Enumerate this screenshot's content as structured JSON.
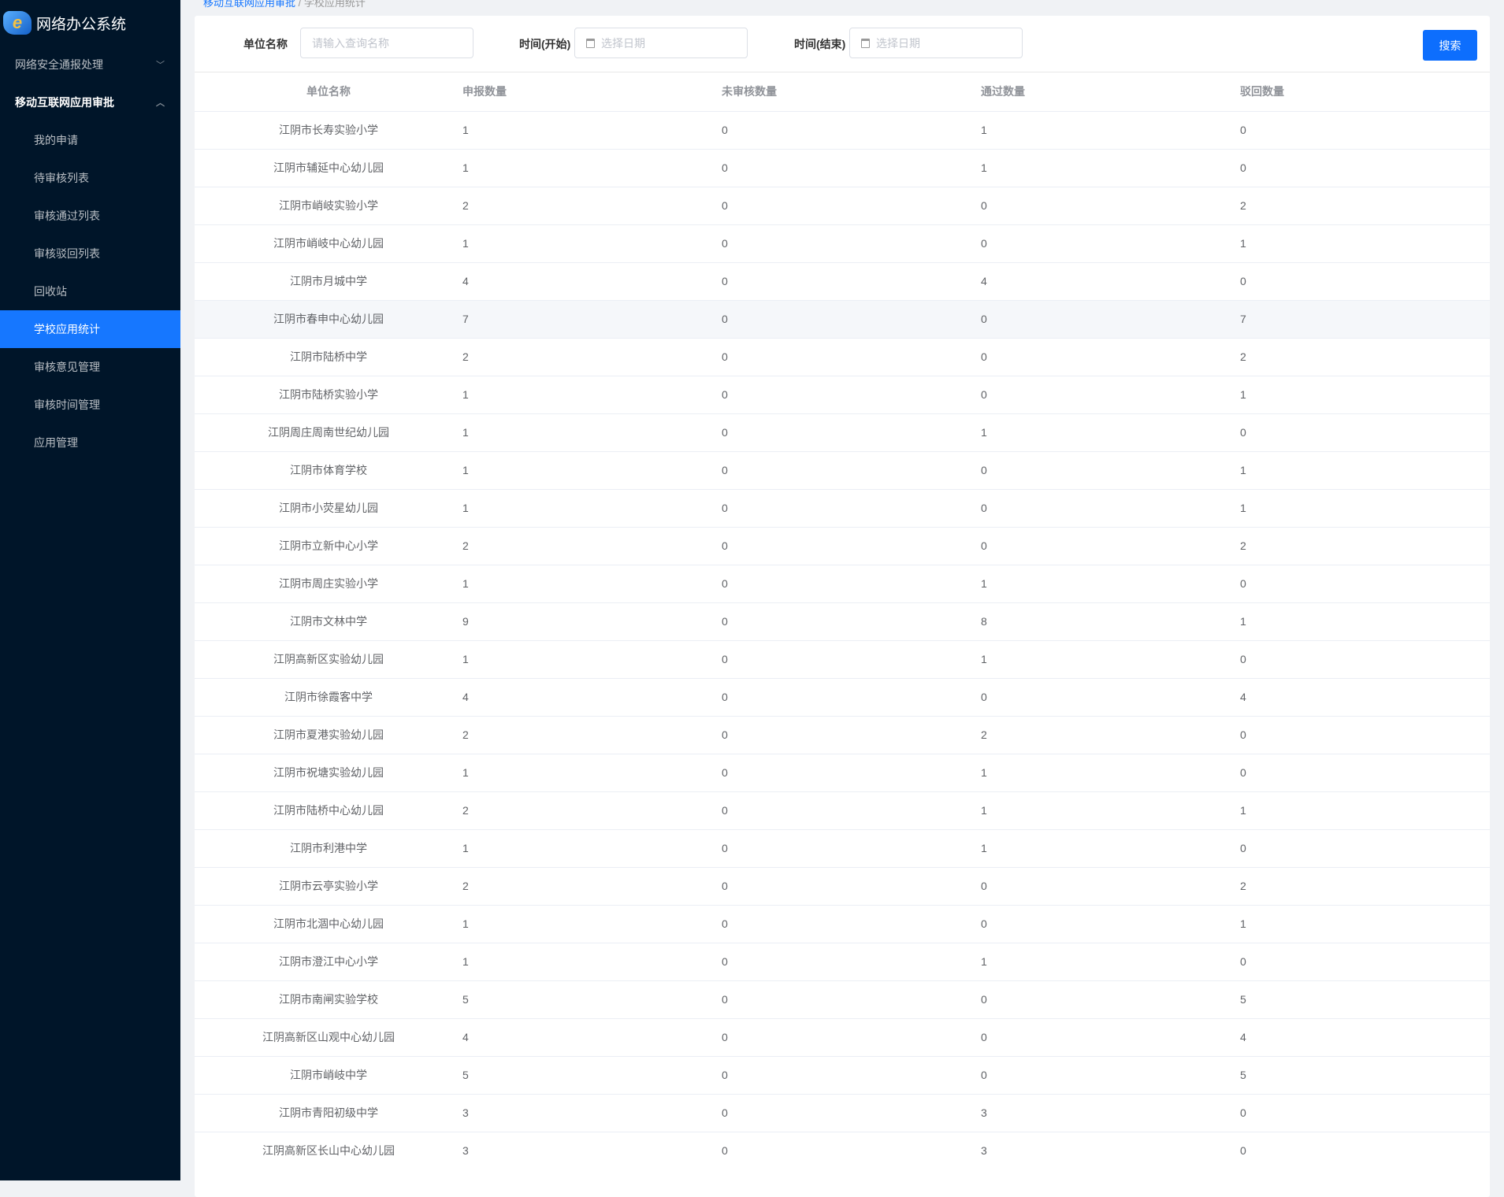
{
  "app": {
    "title": "网络办公系统"
  },
  "sidebar": {
    "items": [
      {
        "label": "网络安全通报处理",
        "type": "group",
        "open": false
      },
      {
        "label": "移动互联网应用审批",
        "type": "group",
        "open": true
      },
      {
        "label": "我的申请",
        "type": "sub"
      },
      {
        "label": "待审核列表",
        "type": "sub"
      },
      {
        "label": "审核通过列表",
        "type": "sub"
      },
      {
        "label": "审核驳回列表",
        "type": "sub"
      },
      {
        "label": "回收站",
        "type": "sub"
      },
      {
        "label": "学校应用统计",
        "type": "sub",
        "active": true
      },
      {
        "label": "审核意见管理",
        "type": "sub"
      },
      {
        "label": "审核时间管理",
        "type": "sub"
      },
      {
        "label": "应用管理",
        "type": "sub"
      }
    ]
  },
  "breadcrumb": {
    "parent": "移动互联网应用审批",
    "current": "学校应用统计"
  },
  "filters": {
    "name_label": "单位名称",
    "name_placeholder": "请输入查询名称",
    "start_label": "时间(开始)",
    "start_placeholder": "选择日期",
    "end_label": "时间(结束)",
    "end_placeholder": "选择日期",
    "search_label": "搜索"
  },
  "table": {
    "columns": [
      "单位名称",
      "申报数量",
      "未审核数量",
      "通过数量",
      "驳回数量"
    ],
    "rows": [
      [
        "江阴市长寿实验小学",
        "1",
        "0",
        "1",
        "0"
      ],
      [
        "江阴市辅延中心幼儿园",
        "1",
        "0",
        "1",
        "0"
      ],
      [
        "江阴市峭岐实验小学",
        "2",
        "0",
        "0",
        "2"
      ],
      [
        "江阴市峭岐中心幼儿园",
        "1",
        "0",
        "0",
        "1"
      ],
      [
        "江阴市月城中学",
        "4",
        "0",
        "4",
        "0"
      ],
      [
        "江阴市春申中心幼儿园",
        "7",
        "0",
        "0",
        "7"
      ],
      [
        "江阴市陆桥中学",
        "2",
        "0",
        "0",
        "2"
      ],
      [
        "江阴市陆桥实验小学",
        "1",
        "0",
        "0",
        "1"
      ],
      [
        "江阴周庄周南世纪幼儿园",
        "1",
        "0",
        "1",
        "0"
      ],
      [
        "江阴市体育学校",
        "1",
        "0",
        "0",
        "1"
      ],
      [
        "江阴市小荧星幼儿园",
        "1",
        "0",
        "0",
        "1"
      ],
      [
        "江阴市立新中心小学",
        "2",
        "0",
        "0",
        "2"
      ],
      [
        "江阴市周庄实验小学",
        "1",
        "0",
        "1",
        "0"
      ],
      [
        "江阴市文林中学",
        "9",
        "0",
        "8",
        "1"
      ],
      [
        "江阴高新区实验幼儿园",
        "1",
        "0",
        "1",
        "0"
      ],
      [
        "江阴市徐霞客中学",
        "4",
        "0",
        "0",
        "4"
      ],
      [
        "江阴市夏港实验幼儿园",
        "2",
        "0",
        "2",
        "0"
      ],
      [
        "江阴市祝塘实验幼儿园",
        "1",
        "0",
        "1",
        "0"
      ],
      [
        "江阴市陆桥中心幼儿园",
        "2",
        "0",
        "1",
        "1"
      ],
      [
        "江阴市利港中学",
        "1",
        "0",
        "1",
        "0"
      ],
      [
        "江阴市云亭实验小学",
        "2",
        "0",
        "0",
        "2"
      ],
      [
        "江阴市北涸中心幼儿园",
        "1",
        "0",
        "0",
        "1"
      ],
      [
        "江阴市澄江中心小学",
        "1",
        "0",
        "1",
        "0"
      ],
      [
        "江阴市南闸实验学校",
        "5",
        "0",
        "0",
        "5"
      ],
      [
        "江阴高新区山观中心幼儿园",
        "4",
        "0",
        "0",
        "4"
      ],
      [
        "江阴市峭岐中学",
        "5",
        "0",
        "0",
        "5"
      ],
      [
        "江阴市青阳初级中学",
        "3",
        "0",
        "3",
        "0"
      ],
      [
        "江阴高新区长山中心幼儿园",
        "3",
        "0",
        "3",
        "0"
      ]
    ]
  }
}
